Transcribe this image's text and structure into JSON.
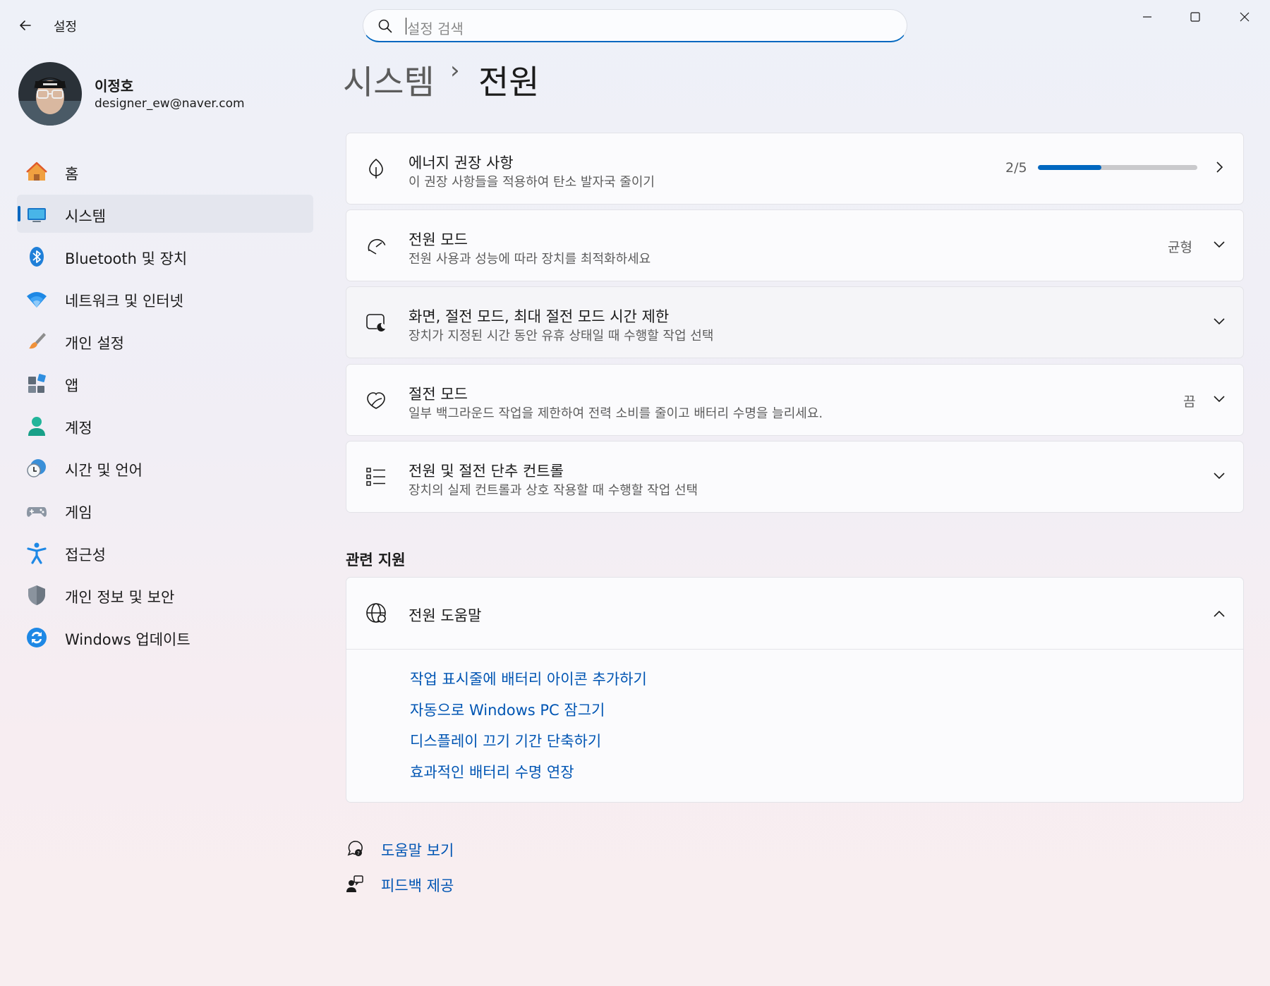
{
  "window": {
    "app_title": "설정",
    "search_placeholder": "설정 검색",
    "minimize_icon": "minimize-icon",
    "maximize_icon": "maximize-icon",
    "close_icon": "close-icon"
  },
  "profile": {
    "name": "이정호",
    "email": "designer_ew@naver.com"
  },
  "sidebar": {
    "items": [
      {
        "label": "홈",
        "icon": "home-icon"
      },
      {
        "label": "시스템",
        "icon": "system-icon",
        "active": true
      },
      {
        "label": "Bluetooth 및 장치",
        "icon": "bluetooth-icon"
      },
      {
        "label": "네트워크 및 인터넷",
        "icon": "wifi-icon"
      },
      {
        "label": "개인 설정",
        "icon": "brush-icon"
      },
      {
        "label": "앱",
        "icon": "apps-icon"
      },
      {
        "label": "계정",
        "icon": "account-icon"
      },
      {
        "label": "시간 및 언어",
        "icon": "time-language-icon"
      },
      {
        "label": "게임",
        "icon": "gamepad-icon"
      },
      {
        "label": "접근성",
        "icon": "accessibility-icon"
      },
      {
        "label": "개인 정보 및 보안",
        "icon": "shield-icon"
      },
      {
        "label": "Windows 업데이트",
        "icon": "update-icon"
      }
    ]
  },
  "breadcrumb": {
    "parent": "시스템",
    "separator": "›",
    "current": "전원"
  },
  "cards": {
    "energy": {
      "title": "에너지 권장 사항",
      "subtitle": "이 권장 사항들을 적용하여 탄소 발자국 줄이기",
      "progress_text": "2/5",
      "progress_fraction": 0.4
    },
    "power_mode": {
      "title": "전원 모드",
      "subtitle": "전원 사용과 성능에 따라 장치를 최적화하세요",
      "value": "균형"
    },
    "screen_sleep": {
      "title": "화면, 절전 모드, 최대 절전 모드 시간 제한",
      "subtitle": "장치가 지정된 시간 동안 유휴 상태일 때 수행할 작업 선택"
    },
    "battery_saver": {
      "title": "절전 모드",
      "subtitle": "일부 백그라운드 작업을 제한하여 전력 소비를 줄이고 배터리 수명을 늘리세요.",
      "value": "끔"
    },
    "power_buttons": {
      "title": "전원 및 절전 단추 컨트롤",
      "subtitle": "장치의 실제 컨트롤과 상호 작용할 때 수행할 작업 선택"
    }
  },
  "related": {
    "section_title": "관련 지원",
    "help_title": "전원 도움말",
    "links": [
      "작업 표시줄에 배터리 아이콘 추가하기",
      "자동으로 Windows PC 잠그기",
      "디스플레이 끄기 기간 단축하기",
      "효과적인 배터리 수명 연장"
    ]
  },
  "footer": {
    "get_help": "도움말 보기",
    "feedback": "피드백 제공"
  },
  "colors": {
    "accent": "#0067c0",
    "link": "#0055b3"
  }
}
